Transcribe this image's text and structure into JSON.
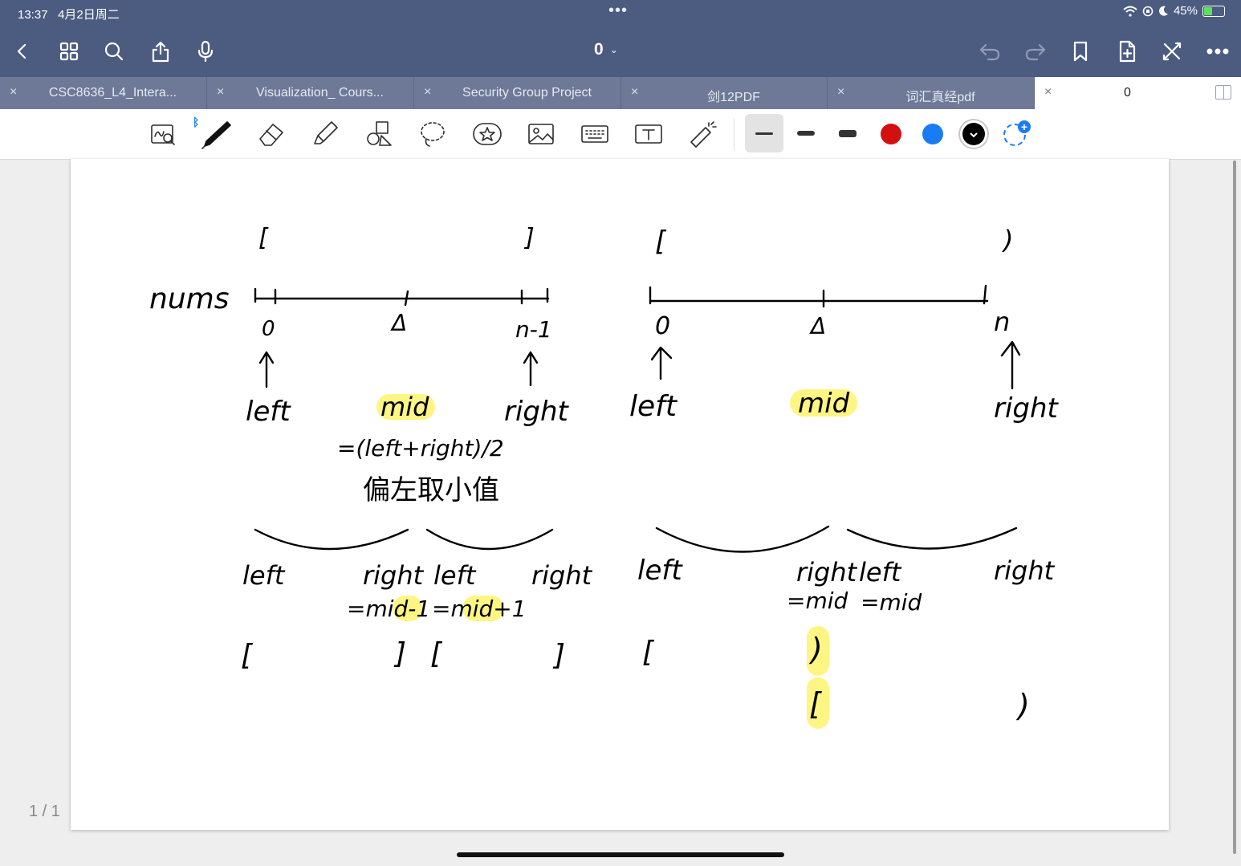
{
  "status_bar": {
    "time": "13:37",
    "date": "4月2日周二",
    "dots": "•••",
    "battery_percent": "45%",
    "battery_level": 0.45
  },
  "nav": {
    "doc_title": "0",
    "title_chevron": "⌄",
    "left_icons": [
      "back-icon",
      "grid-icon",
      "search-icon",
      "share-icon",
      "microphone-icon"
    ],
    "right_icons": [
      "undo-icon",
      "redo-icon",
      "bookmark-icon",
      "add-page-icon",
      "close-x-icon",
      "more-icon"
    ]
  },
  "tabs": [
    {
      "label": "CSC8636_L4_Intera...",
      "close": "×",
      "active": false
    },
    {
      "label": "Visualization_ Cours...",
      "close": "×",
      "active": false
    },
    {
      "label": "Security Group Project",
      "close": "×",
      "active": false
    },
    {
      "label": "剑12PDF",
      "close": "×",
      "active": false
    },
    {
      "label": "词汇真经pdf",
      "close": "×",
      "active": false
    },
    {
      "label": "0",
      "close": "×",
      "active": true
    }
  ],
  "toolbar": {
    "tools": [
      "zoom-window-icon",
      "pen-icon",
      "eraser-icon",
      "highlighter-icon",
      "shapes-icon",
      "lasso-icon",
      "sticker-icon",
      "image-icon",
      "keyboard-icon",
      "text-box-icon",
      "laser-pointer-icon"
    ],
    "selected_tool": "pen-icon",
    "stroke_widths": [
      "thin",
      "medium",
      "thick"
    ],
    "selected_stroke": "thin",
    "colors": [
      "#d40f0f",
      "#1a7cf5",
      "#000000"
    ],
    "selected_color": "#000000",
    "bluetooth_mark": "ᛒ",
    "add_color_mark": "+"
  },
  "notes": {
    "left_panel": {
      "array_label": "nums",
      "bracket_open": "[",
      "bracket_close": "]",
      "ticks": [
        "0",
        "Δ",
        "n-1"
      ],
      "pointers": [
        "left",
        "mid",
        "right"
      ],
      "mid_formula": "=(left+right)/2",
      "mid_note": "偏左取小值",
      "sub_left": {
        "labels": [
          "left",
          "right"
        ],
        "update": "=mid-1",
        "brackets": [
          "[",
          "]"
        ]
      },
      "sub_right": {
        "labels": [
          "left",
          "right"
        ],
        "update": "=mid+1",
        "brackets": [
          "[",
          "]"
        ]
      }
    },
    "right_panel": {
      "bracket_open": "[",
      "bracket_close": ")",
      "ticks": [
        "0",
        "Δ",
        "n"
      ],
      "pointers": [
        "left",
        "mid",
        "right"
      ],
      "sub_left": {
        "labels": [
          "left",
          "right"
        ],
        "update": "=mid",
        "brackets": [
          "[",
          ")"
        ]
      },
      "sub_right": {
        "labels": [
          "left",
          "right"
        ],
        "update": "=mid",
        "brackets": [
          "[",
          ")"
        ]
      }
    }
  },
  "page_counter": "1 / 1"
}
